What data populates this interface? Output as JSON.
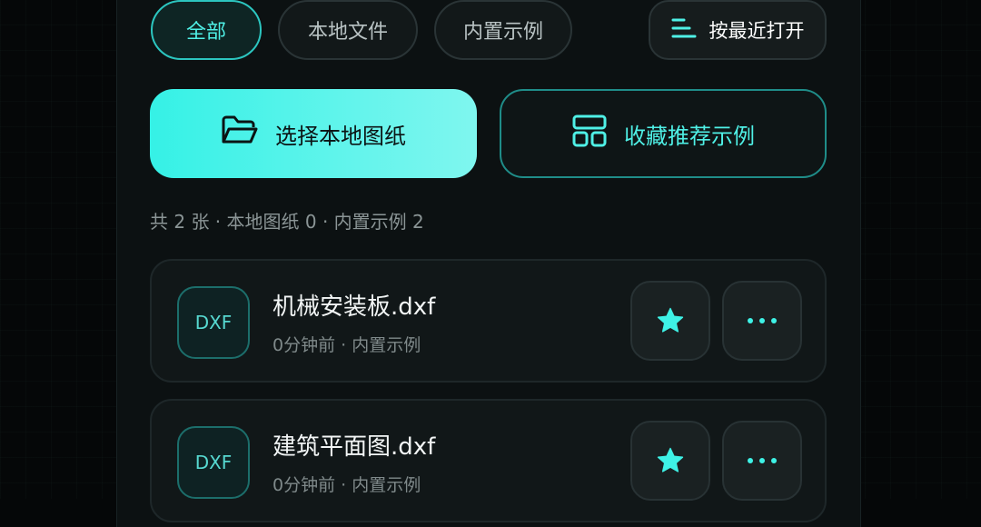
{
  "filters": {
    "all": "全部",
    "local": "本地文件",
    "builtin": "内置示例",
    "sort": "按最近打开"
  },
  "actions": {
    "select_local": "选择本地图纸",
    "favorites": "收藏推荐示例"
  },
  "summary": "共 2 张 · 本地图纸 0 · 内置示例 2",
  "files": [
    {
      "badge": "DXF",
      "name": "机械安装板.dxf",
      "meta": "0分钟前 · 内置示例"
    },
    {
      "badge": "DXF",
      "name": "建筑平面图.dxf",
      "meta": "0分钟前 · 内置示例"
    }
  ],
  "colors": {
    "accent": "#35f1e6",
    "background": "#050708",
    "panel": "#0c1112"
  },
  "icons": {
    "sort": "sort-lines-icon",
    "folder": "folder-open-icon",
    "grid": "grid-layout-icon",
    "star": "star-icon",
    "more": "more-horizontal-icon"
  }
}
